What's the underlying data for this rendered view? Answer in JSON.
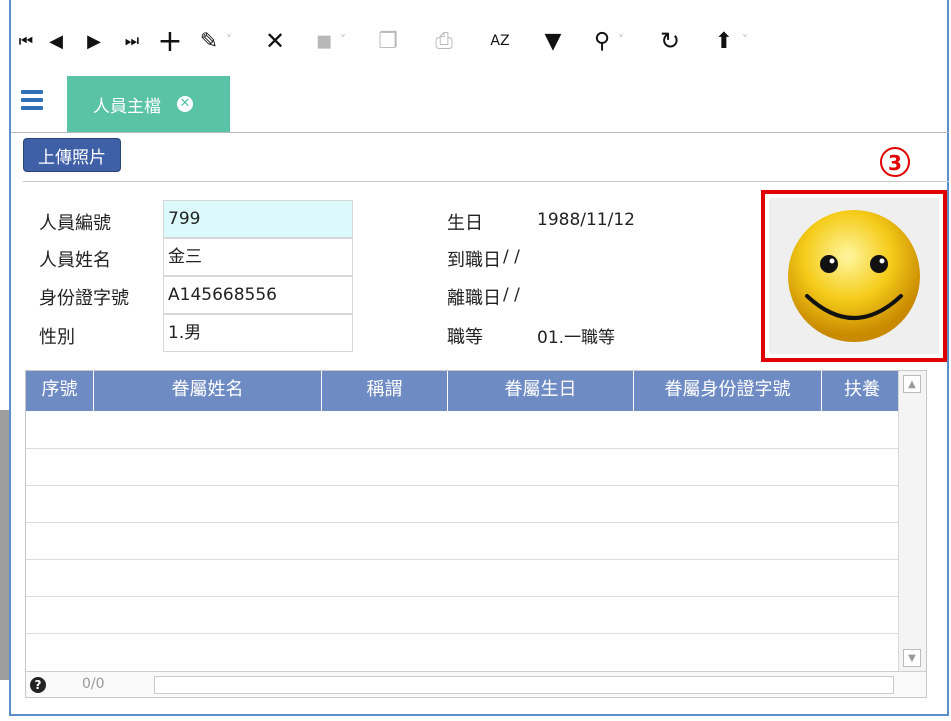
{
  "toolbar": {
    "first_icon": "⏮",
    "prev_icon": "◀",
    "next_icon": "▶",
    "last_icon": "⏭",
    "add_icon": "+",
    "edit_icon": "✎",
    "delete_icon": "✕",
    "save_icon": "▪",
    "copy_icon": "❐",
    "print_icon": "⎙",
    "sort_label": "AZ",
    "filter_icon": "▼",
    "search_icon": "⚲",
    "refresh_icon": "↻",
    "export_icon": "⬆",
    "caret": "˅"
  },
  "tab": {
    "label": "人員主檔",
    "close_icon": "✕"
  },
  "upload_button": "上傳照片",
  "annotation_marker": "3",
  "form": {
    "left": [
      {
        "label": "人員編號",
        "value": "799"
      },
      {
        "label": "人員姓名",
        "value": "金三"
      },
      {
        "label": "身份證字號",
        "value": "A145668556"
      },
      {
        "label": "性別",
        "value": "1.男"
      }
    ],
    "right": [
      {
        "label": "生日",
        "value": "1988/11/12"
      },
      {
        "label": "到職日",
        "value": "/ /"
      },
      {
        "label": "離職日",
        "value": "/ /"
      },
      {
        "label": "職等",
        "value": "01.一職等"
      }
    ]
  },
  "grid": {
    "columns": [
      "序號",
      "眷屬姓名",
      "稱謂",
      "眷屬生日",
      "眷屬身份證字號",
      "扶養"
    ],
    "pager_count": "0/0",
    "help_icon": "?"
  },
  "colors": {
    "tab": "#5bc3a5",
    "header": "#6f8bc4",
    "button": "#3f5fa6",
    "highlight": "#e00000"
  }
}
